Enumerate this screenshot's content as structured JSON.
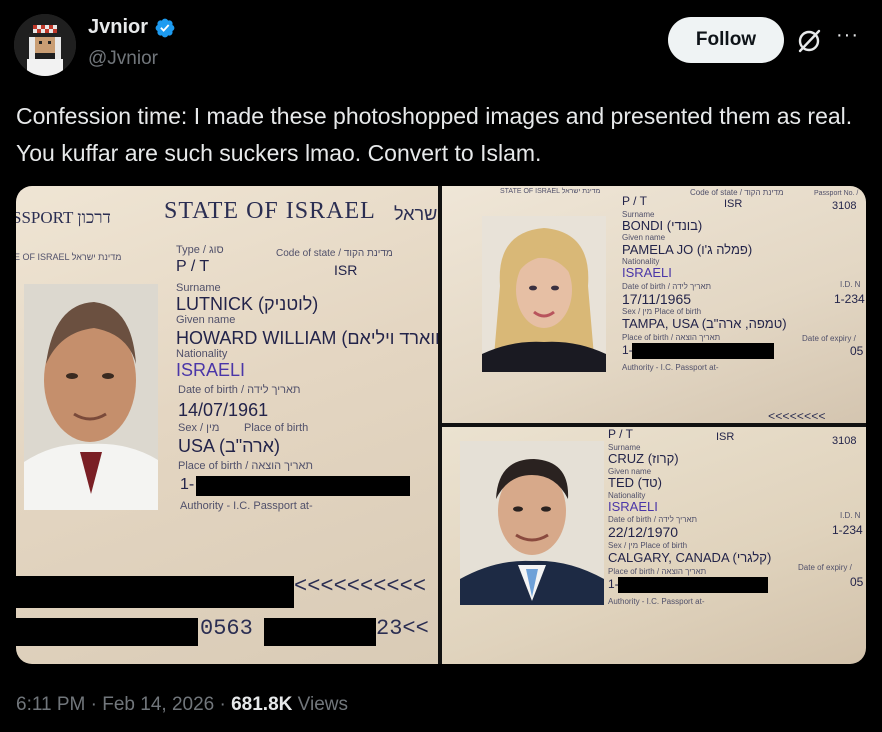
{
  "user": {
    "display_name": "Jvnior",
    "handle": "@Jvnior",
    "avatar_icon": "pixel-avatar-icon",
    "verified_color": "#1d9bf0"
  },
  "header": {
    "follow_label": "Follow",
    "grok_icon": "grok-icon",
    "more_label": "···"
  },
  "tweet": {
    "text": "Confession time: I made these photoshopped images and presented them as real. You kuffar are such suckers lmao. Convert to Islam."
  },
  "passport_main": {
    "state_header": "STATE OF ISRAEL",
    "state_hebrew": "מדינת ישראל",
    "passport_word": "SSPORT דרכון",
    "small_state": "E OF ISRAEL מדינת ישראל",
    "type_label": "Type / סוג",
    "type_value": "P / T",
    "code_label": "Code of state / מדינת הקוד",
    "code_value": "ISR",
    "surname_label": "Surname",
    "surname_value": "LUTNICK (לוטניק)",
    "given_label": "Given name",
    "given_value": "HOWARD WILLIAM (הווארד ויליאם)",
    "nationality_label": "Nationality",
    "nationality_value": "ISRAELI",
    "dob_label": "Date of birth / תאריך לידה",
    "dob_value": "14/07/1961",
    "sex_label": "Sex / מין",
    "pob_label": "Place of birth",
    "pob_value": "USA (ארה\"ב)",
    "place_issue_label": "Place of birth / תאריך הוצאה",
    "issue_prefix": "1-",
    "authority": "Authority - I.C. Passport at-",
    "mrz1": "<<<<<<<<<<",
    "mrz2_a": "0563",
    "mrz2_b": "23<<"
  },
  "passport_top": {
    "state_small": "STATE OF ISRAEL מדינת ישראל",
    "type_value": "P / T",
    "code_label": "Code of state / מדינת הקוד",
    "code_value": "ISR",
    "passport_no_label": "Passport No. /",
    "passport_no": "3108",
    "surname_label": "Surname",
    "surname_value": "BONDI (בונדי)",
    "given_label": "Given name",
    "given_value": "PAMELA JO (פמלה ג'ו)",
    "nationality_label": "Nationality",
    "nationality_value": "ISRAELI",
    "dob_label": "Date of birth / תאריך לידה",
    "dob_value": "17/11/1965",
    "sex_label": "Sex / מין   Place of birth",
    "pob_value": "TAMPA, USA (טמפה, ארה\"ב)",
    "place_issue_label": "Place of birth / תאריך הוצאה",
    "issue_prefix": "1-",
    "authority": "Authority - I.C. Passport at-",
    "id_label": "I.D. N",
    "id_value": "1-234",
    "expiry_label": "Date of expiry /",
    "expiry_value": "05"
  },
  "passport_bottom": {
    "type_value": "P / T",
    "code_value": "ISR",
    "passport_no": "3108",
    "surname_label": "Surname",
    "surname_value": "CRUZ (קרוז)",
    "given_label": "Given name",
    "given_value": "TED (טד)",
    "nationality_label": "Nationality",
    "nationality_value": "ISRAELI",
    "dob_label": "Date of birth / תאריך לידה",
    "dob_value": "22/12/1970",
    "sex_label": "Sex / מין   Place of birth",
    "pob_value": "CALGARY, CANADA (קלגרי)",
    "place_issue_label": "Place of birth / תאריך הוצאה",
    "issue_prefix": "1-",
    "authority": "Authority - I.C. Passport at-",
    "id_label": "I.D. N",
    "id_value": "1-234",
    "expiry_label": "Date of expiry /",
    "expiry_value": "05"
  },
  "footer": {
    "time": "6:11 PM · Feb 14, 2026 · ",
    "views_count": "681.8K",
    "views_label": " Views"
  }
}
